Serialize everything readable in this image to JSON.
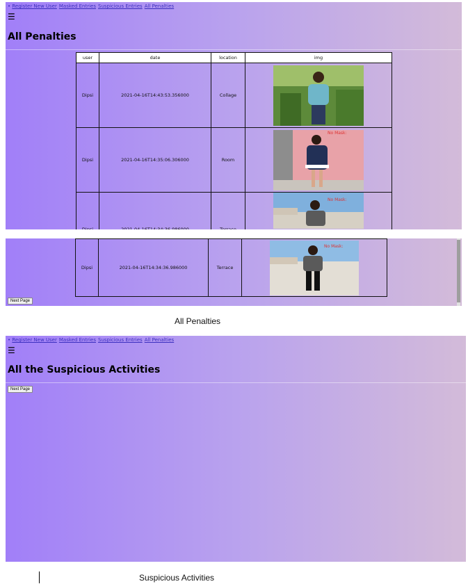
{
  "nav": {
    "bullet": "•",
    "links": [
      "Register New User",
      "Masked Entries",
      "Suspicious Entries",
      "All Penalties"
    ]
  },
  "menu_icon": "☰",
  "penalties": {
    "title": "All Penalties",
    "columns": [
      "user",
      "date",
      "location",
      "img"
    ],
    "rows": [
      {
        "user": "Dipsi",
        "date": "2021-04-16T14:43:53.356000",
        "location": "Collage",
        "img_desc": "person-in-blue-top"
      },
      {
        "user": "Dipsi",
        "date": "2021-04-16T14:35:06.306000",
        "location": "Room",
        "img_desc": "person-in-navy-dress"
      },
      {
        "user": "Dipsi",
        "date": "2021-04-16T14:34:36.986000",
        "location": "Terrace",
        "img_desc": "person-on-terrace"
      }
    ],
    "continued_row": {
      "user": "Dipsi",
      "date": "2021-04-16T14:34:36.986000",
      "location": "Terrace"
    },
    "next_page": "Next Page",
    "caption": "All Penalties"
  },
  "suspicious": {
    "title": "All the Suspicious Activities",
    "next_page": "Next Page",
    "caption": "Suspicious Activities"
  },
  "colors": {
    "gradient_start": "#a17ff8",
    "gradient_end": "#d3bbd9",
    "link": "#3b2fbf"
  },
  "overlay_text": "No Mask:"
}
